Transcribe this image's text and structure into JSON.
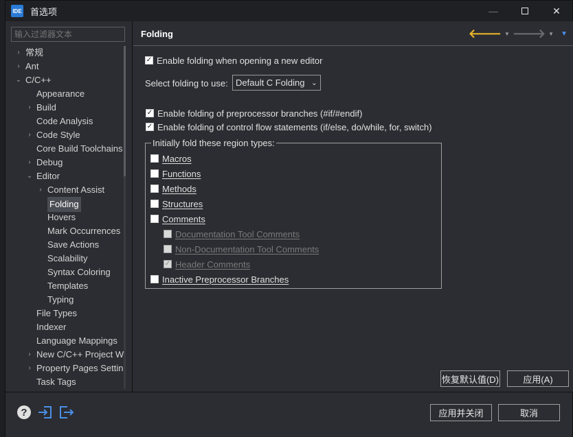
{
  "window": {
    "app_icon": "IDE",
    "title": "首选项",
    "controls": {
      "minimize": "—",
      "close": "✕"
    }
  },
  "filter": {
    "placeholder": "输入过滤器文本"
  },
  "tree": [
    {
      "label": "常规",
      "arrow": "›"
    },
    {
      "label": "Ant",
      "arrow": "›"
    },
    {
      "label": "C/C++",
      "arrow": "⌄"
    },
    {
      "label": "Appearance",
      "arrow": ""
    },
    {
      "label": "Build",
      "arrow": "›"
    },
    {
      "label": "Code Analysis",
      "arrow": ""
    },
    {
      "label": "Code Style",
      "arrow": "›"
    },
    {
      "label": "Core Build Toolchains",
      "arrow": ""
    },
    {
      "label": "Debug",
      "arrow": "›"
    },
    {
      "label": "Editor",
      "arrow": "⌄"
    },
    {
      "label": "Content Assist",
      "arrow": "›"
    },
    {
      "label": "Folding",
      "arrow": ""
    },
    {
      "label": "Hovers",
      "arrow": ""
    },
    {
      "label": "Mark Occurrences",
      "arrow": ""
    },
    {
      "label": "Save Actions",
      "arrow": ""
    },
    {
      "label": "Scalability",
      "arrow": ""
    },
    {
      "label": "Syntax Coloring",
      "arrow": ""
    },
    {
      "label": "Templates",
      "arrow": ""
    },
    {
      "label": "Typing",
      "arrow": ""
    },
    {
      "label": "File Types",
      "arrow": ""
    },
    {
      "label": "Indexer",
      "arrow": ""
    },
    {
      "label": "Language Mappings",
      "arrow": ""
    },
    {
      "label": "New C/C++ Project Wizard",
      "arrow": "›"
    },
    {
      "label": "Property Pages Settings",
      "arrow": "›"
    },
    {
      "label": "Task Tags",
      "arrow": ""
    }
  ],
  "page": {
    "title": "Folding",
    "nav": {
      "back": "🡐",
      "forward": "🡒",
      "caret": "▼",
      "menu": "▼"
    },
    "enable_folding": {
      "label": "Enable folding when opening a new editor",
      "checked": true
    },
    "select_label": "Select folding to use:",
    "select_value": "Default C Folding",
    "select_caret": "⌄",
    "preprocessor": {
      "label": "Enable folding of preprocessor branches (#if/#endif)",
      "checked": true
    },
    "control_flow": {
      "label": "Enable folding of control flow statements (if/else, do/while, for, switch)",
      "checked": true
    },
    "group_title": "Initially fold these region types:",
    "region_types": [
      {
        "label": "Macros",
        "checked": false,
        "enabled": true
      },
      {
        "label": "Functions",
        "checked": false,
        "enabled": true
      },
      {
        "label": "Methods",
        "checked": false,
        "enabled": true
      },
      {
        "label": "Structures",
        "checked": false,
        "enabled": true
      },
      {
        "label": "Comments",
        "checked": false,
        "enabled": true
      },
      {
        "label": "Documentation Tool Comments",
        "checked": false,
        "enabled": false
      },
      {
        "label": "Non-Documentation Tool Comments",
        "checked": false,
        "enabled": false
      },
      {
        "label": "Header Comments",
        "checked": true,
        "enabled": false
      },
      {
        "label": "Inactive Preprocessor Branches",
        "checked": false,
        "enabled": true
      }
    ],
    "restore_defaults": "恢复默认值(D)",
    "apply": "应用(A)"
  },
  "footer": {
    "help_glyph": "?",
    "import_icon": "import-icon",
    "export_icon": "export-icon",
    "apply_close": "应用并关闭",
    "cancel": "取消"
  },
  "colors": {
    "background": "#2b2d32",
    "accent_blue": "#4b8ee8",
    "back_arrow": "#e8b22a"
  }
}
